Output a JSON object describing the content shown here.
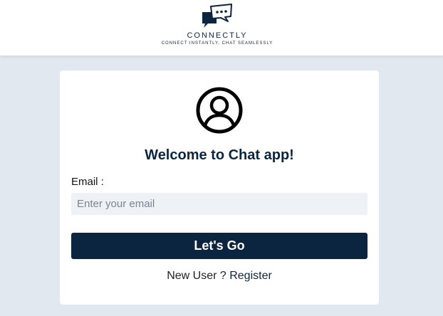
{
  "header": {
    "brand_name": "CONNECTLY",
    "tagline": "CONNECT INSTANTLY, CHAT SEAMLESSLY",
    "logo_icon": "chat-bubbles-icon"
  },
  "login": {
    "avatar_icon": "user-circle-icon",
    "title": "Welcome to Chat app!",
    "email_label": "Email :",
    "email_placeholder": "Enter your email",
    "email_value": "",
    "submit_label": "Let's Go",
    "new_user_text": "New User ?",
    "register_label": "Register"
  },
  "colors": {
    "page_background": "#e2e8f0",
    "brand_navy": "#0b2540",
    "input_background": "#eef2f7"
  }
}
